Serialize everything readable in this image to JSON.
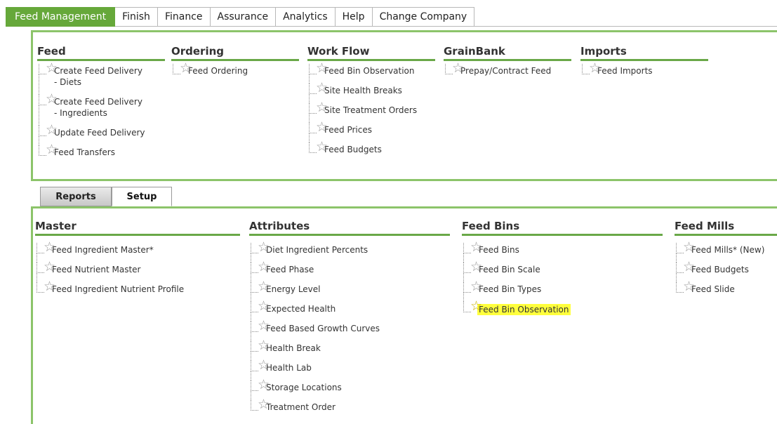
{
  "topnav": {
    "tabs": [
      {
        "label": "Feed Management",
        "active": true
      },
      {
        "label": "Finish"
      },
      {
        "label": "Finance"
      },
      {
        "label": "Assurance"
      },
      {
        "label": "Analytics"
      },
      {
        "label": "Help"
      },
      {
        "label": "Change Company"
      }
    ]
  },
  "top_panel": {
    "feed": {
      "header": "Feed",
      "items": [
        "Create Feed Delivery - Diets",
        "Create Feed Delivery - Ingredients",
        "Update Feed Delivery",
        "Feed Transfers"
      ]
    },
    "ordering": {
      "header": "Ordering",
      "items": [
        "Feed Ordering"
      ]
    },
    "workflow": {
      "header": "Work Flow",
      "items": [
        "Feed Bin Observation",
        "Site Health Breaks",
        "Site Treatment Orders",
        "Feed Prices",
        "Feed Budgets"
      ]
    },
    "grainbank": {
      "header": "GrainBank",
      "items": [
        "Prepay/Contract Feed"
      ]
    },
    "imports": {
      "header": "Imports",
      "items": [
        "Feed Imports"
      ]
    }
  },
  "subtabs": {
    "reports": "Reports",
    "setup": "Setup"
  },
  "bottom_panel": {
    "master": {
      "header": "Master",
      "items": [
        "Feed Ingredient Master*",
        "Feed Nutrient Master",
        "Feed Ingredient Nutrient Profile"
      ]
    },
    "attributes": {
      "header": "Attributes",
      "items": [
        "Diet Ingredient Percents",
        "Feed Phase",
        "Energy Level",
        "Expected Health",
        "Feed Based Growth Curves",
        "Health Break",
        "Health Lab",
        "Storage Locations",
        "Treatment Order"
      ]
    },
    "feedbins": {
      "header": "Feed Bins",
      "items": [
        "Feed Bins",
        "Feed Bin Scale",
        "Feed Bin Types",
        "Feed Bin Observation"
      ],
      "highlighted": "Feed Bin Observation"
    },
    "feedmills": {
      "header": "Feed Mills",
      "items": [
        "Feed Mills* (New)",
        "Feed Budgets",
        "Feed Slide"
      ]
    }
  },
  "colors": {
    "accent": "#66a83a",
    "panel_border": "#8cc46a",
    "highlight": "#ffff3c"
  },
  "icons": {
    "item_icon": "star-outline-icon"
  }
}
